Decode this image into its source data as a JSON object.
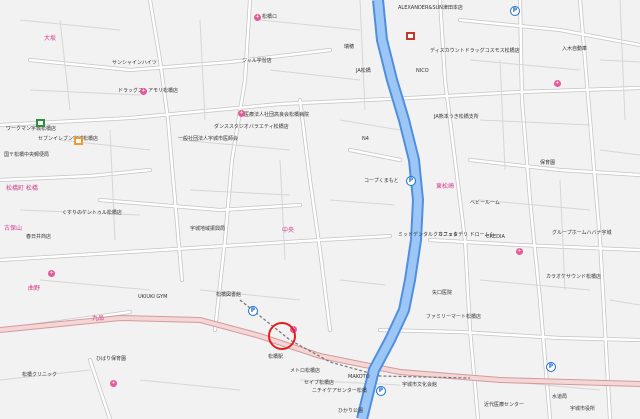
{
  "map": {
    "labels": [
      {
        "id": "alexander",
        "text": "ALEXANDER&SUN津田本店"
      },
      {
        "id": "bus-stop-top",
        "text": "松橋ロ"
      },
      {
        "id": "mizuho",
        "text": "瑞穂"
      },
      {
        "id": "jm-shop",
        "text": "ジャル学習店"
      },
      {
        "id": "apartments-1",
        "text": "サンシャインハイツ"
      },
      {
        "id": "drugstore",
        "text": "ドラッグストアモリ松橋店"
      },
      {
        "id": "workman",
        "text": "ワークマン宇城松橋店"
      },
      {
        "id": "post",
        "text": "国〒松橋中央郵便局"
      },
      {
        "id": "dance",
        "text": "ダンススタジオバラエティ松橋店"
      },
      {
        "id": "medical-assoc",
        "text": "一般社団法人宇城市医師会"
      },
      {
        "id": "hospital-1",
        "text": "医療法人社団高良会松橋病院"
      },
      {
        "id": "nico",
        "text": "NICO"
      },
      {
        "id": "n4",
        "text": "N4"
      },
      {
        "id": "coop",
        "text": "コープくまもと"
      },
      {
        "id": "ja",
        "text": "JA熊本うき松橋支所"
      },
      {
        "id": "district-1",
        "text": "松橋町 松橋"
      },
      {
        "id": "district-2",
        "text": "大坂"
      },
      {
        "id": "district-3",
        "text": "中央"
      },
      {
        "id": "district-4",
        "text": "東松崎"
      },
      {
        "id": "district-5",
        "text": "古保山"
      },
      {
        "id": "district-6",
        "text": "曲野"
      },
      {
        "id": "district-7",
        "text": "九品"
      },
      {
        "id": "uzuki-gym",
        "text": "UKIUKI GYM"
      },
      {
        "id": "seven",
        "text": "セブンイレブン宇城松橋店"
      },
      {
        "id": "kusuri",
        "text": "くすりのケントゥル松橋店"
      },
      {
        "id": "kasugai",
        "text": "春日井商店"
      },
      {
        "id": "prefecture-office",
        "text": "宇城地域振興局"
      },
      {
        "id": "library",
        "text": "松橋図書館"
      },
      {
        "id": "cafe",
        "text": "カフェ＆デリ ドロームシ"
      },
      {
        "id": "dental",
        "text": "ミッドデンタルクリニック"
      },
      {
        "id": "baby",
        "text": "ベビールーム"
      },
      {
        "id": "yaguchi",
        "text": "矢口医院"
      },
      {
        "id": "famima",
        "text": "ファミリーマート松橋店"
      },
      {
        "id": "credia",
        "text": "CREDIA"
      },
      {
        "id": "group-home",
        "text": "グループホームハバナ宇城"
      },
      {
        "id": "iriki",
        "text": "入木自動車"
      },
      {
        "id": "karaoke",
        "text": "カラオケサウンド松橋店"
      },
      {
        "id": "matsuhashi-sta",
        "text": "松橋駅"
      },
      {
        "id": "nursery",
        "text": "保育園"
      },
      {
        "id": "kindergarten",
        "text": "ひばり保育園"
      },
      {
        "id": "clinic-2",
        "text": "松橋クリニック"
      },
      {
        "id": "meitetsu",
        "text": "メトロ松橋店"
      },
      {
        "id": "seibu",
        "text": "セイブ松橋店"
      },
      {
        "id": "ukiko",
        "text": "ひかり公園"
      },
      {
        "id": "pharmacy",
        "text": "ディスカウントドラッグコスモス松橋店"
      },
      {
        "id": "jfc",
        "text": "JA松橋"
      },
      {
        "id": "mako",
        "text": "MAKOTO"
      },
      {
        "id": "bunka",
        "text": "宇城市文化会館"
      },
      {
        "id": "nichii",
        "text": "ニチイケアセンター松橋"
      },
      {
        "id": "mizu",
        "text": "水道局"
      },
      {
        "id": "kindai",
        "text": "近代医療センター"
      },
      {
        "id": "nishi",
        "text": "宇城市役所"
      }
    ],
    "icons": {
      "poi": "hospital-marker-icon",
      "parking": "parking-icon",
      "store": "store-icon",
      "location": "location-circle-icon"
    },
    "colors": {
      "background": "#f2f2f2",
      "road": "#ffffff",
      "road_outline": "#b9b9b9",
      "main_road": "#f3d2d2",
      "river": "#6aa3e8",
      "district_text": "#d23c8c",
      "marker": "#e02020"
    }
  }
}
